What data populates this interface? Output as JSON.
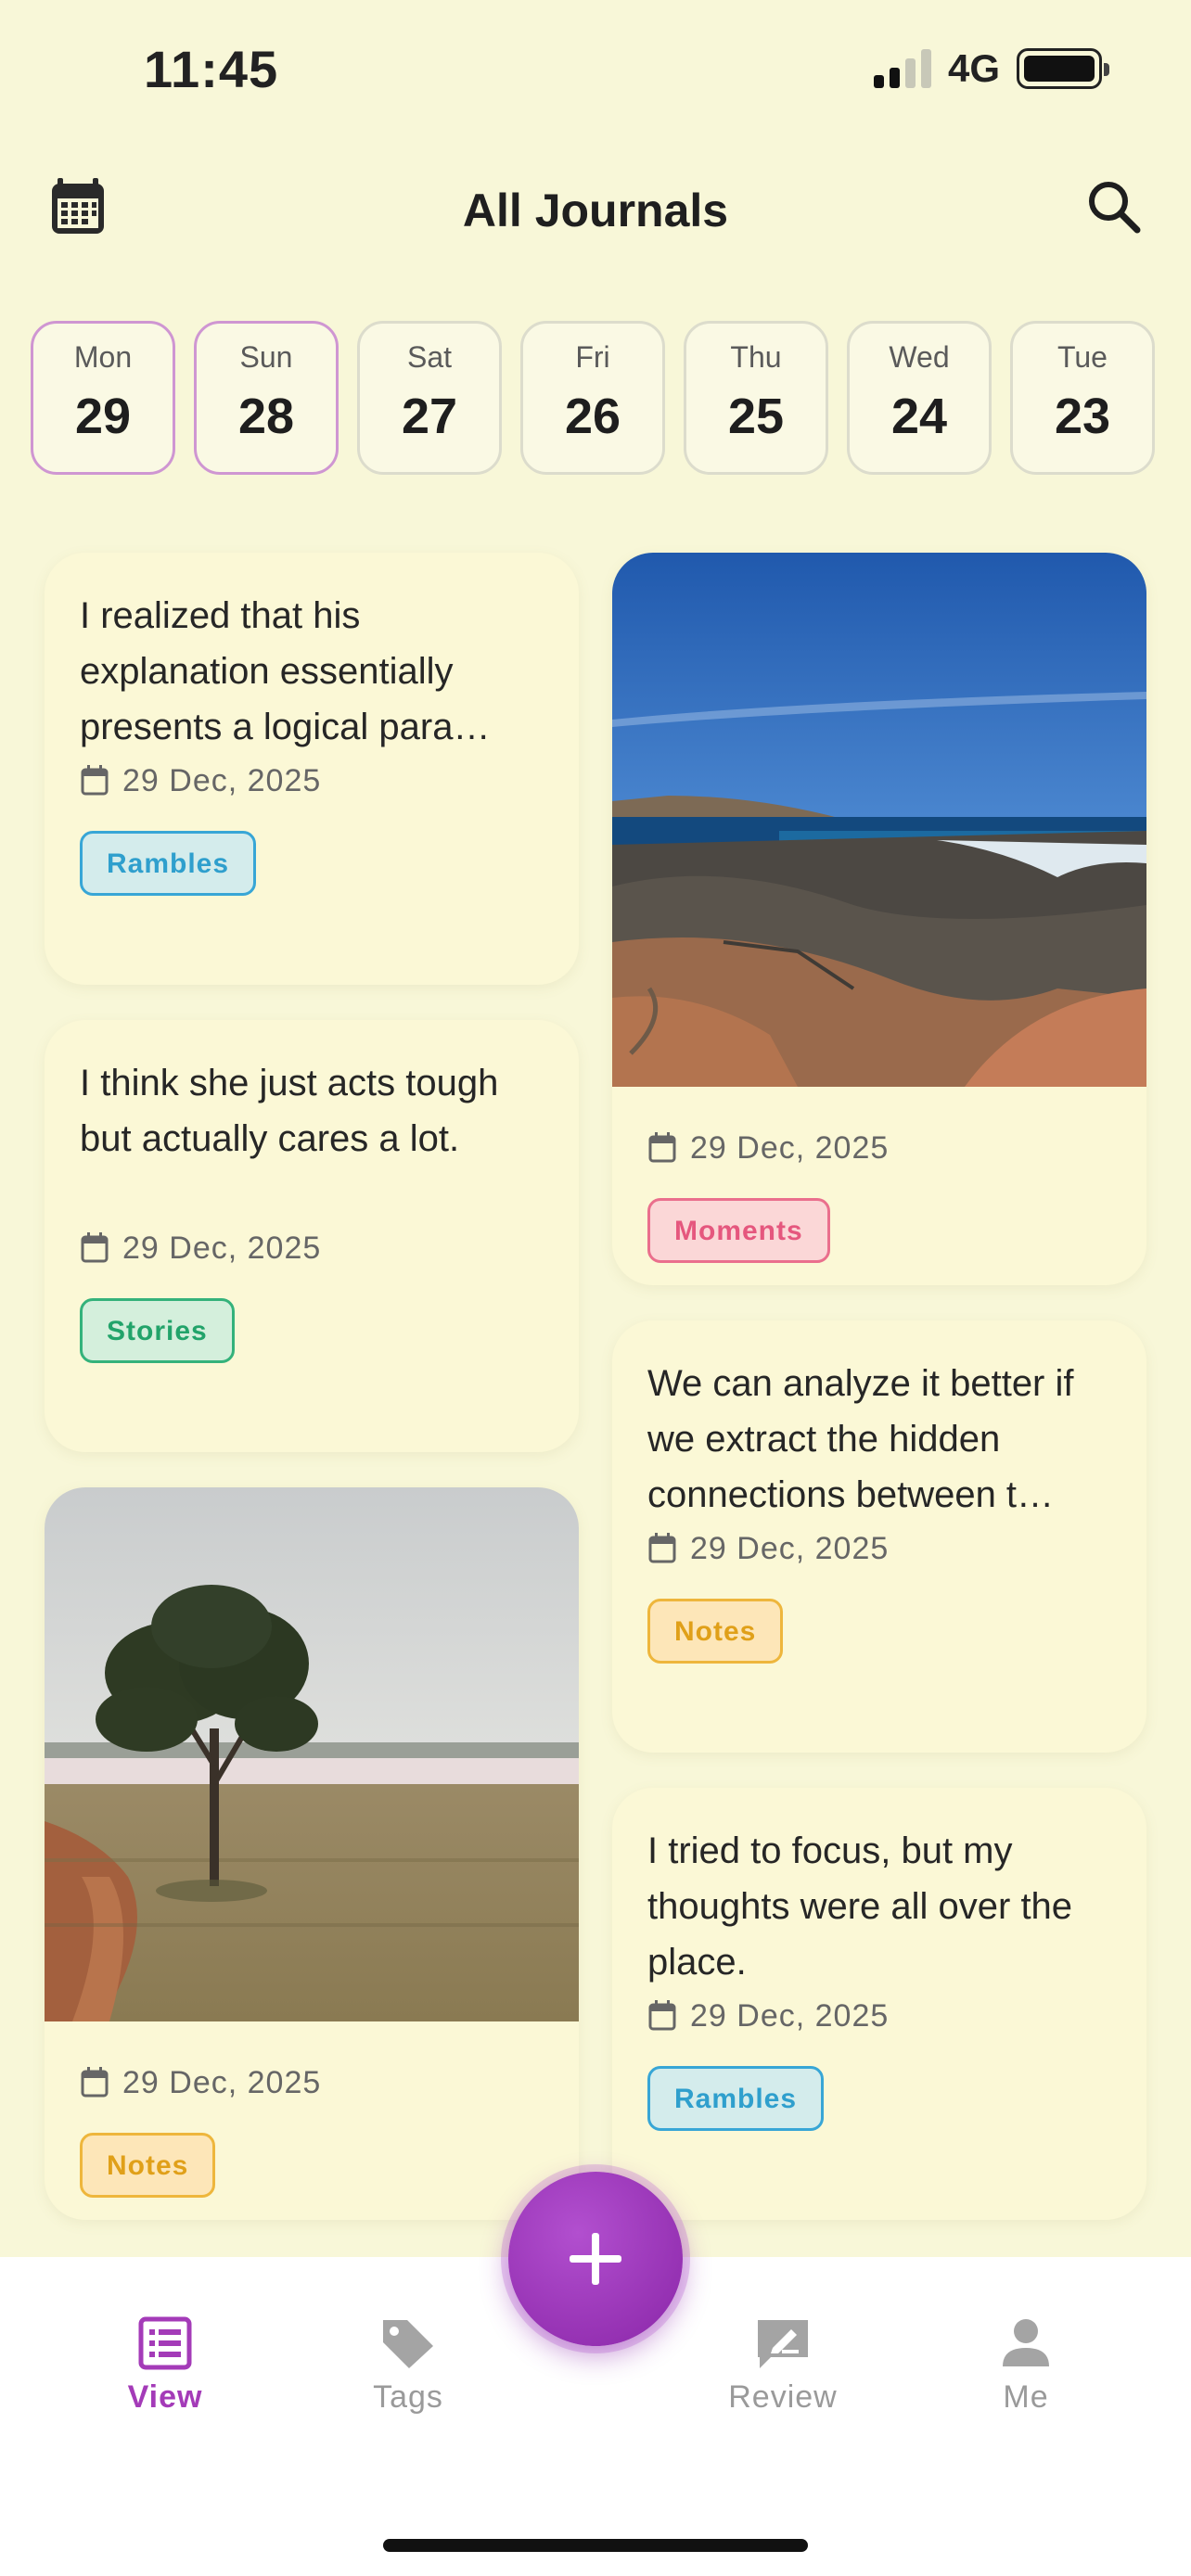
{
  "status_bar": {
    "time": "11:45",
    "network": "4G"
  },
  "header": {
    "title": "All Journals",
    "calendar_icon": "calendar-icon",
    "search_icon": "search-icon"
  },
  "days": [
    {
      "name": "Mon",
      "num": "29",
      "selected": true
    },
    {
      "name": "Sun",
      "num": "28",
      "selected": true
    },
    {
      "name": "Sat",
      "num": "27",
      "selected": false
    },
    {
      "name": "Fri",
      "num": "26",
      "selected": false
    },
    {
      "name": "Thu",
      "num": "25",
      "selected": false
    },
    {
      "name": "Wed",
      "num": "24",
      "selected": false
    },
    {
      "name": "Tue",
      "num": "23",
      "selected": false
    }
  ],
  "entries": [
    {
      "text": "I realized that his explanation essentially presents a logical para…",
      "date": "29 Dec, 2025",
      "tag": "Rambles"
    },
    {
      "text": "I think she just acts tough but actually cares a lot.",
      "date": "29 Dec, 2025",
      "tag": "Stories"
    },
    {
      "photo": "tree-landscape",
      "date": "29 Dec, 2025",
      "tag": "Notes"
    },
    {
      "photo": "rocky-coast",
      "date": "29 Dec, 2025",
      "tag": "Moments"
    },
    {
      "text": "We can analyze it better if we extract the hidden connections between t…",
      "date": "29 Dec, 2025",
      "tag": "Notes"
    },
    {
      "text": "I tried to focus, but my thoughts were all over the place.",
      "date": "29 Dec, 2025",
      "tag": "Rambles"
    }
  ],
  "tabbar": {
    "view": "View",
    "tags": "Tags",
    "review": "Review",
    "me": "Me"
  },
  "colors": {
    "accent": "#a43bb8",
    "background": "#f8f7d8"
  }
}
